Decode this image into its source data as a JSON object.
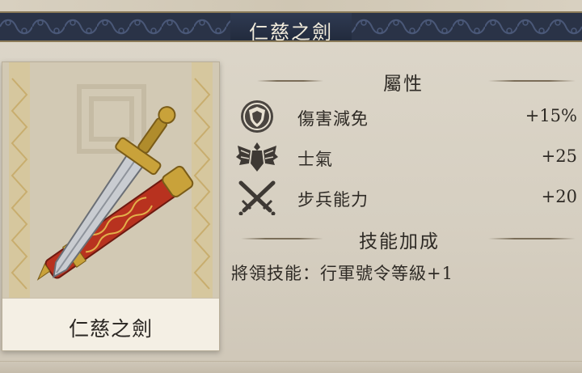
{
  "header": {
    "title": "仁慈之劍"
  },
  "item_card": {
    "name": "仁慈之劍",
    "image_icon": "sword-with-red-scabbard"
  },
  "attributes": {
    "title": "屬性",
    "rows": [
      {
        "icon": "shield-icon",
        "label": "傷害減免",
        "value": "+15%"
      },
      {
        "icon": "eagle-icon",
        "label": "士氣",
        "value": "+25"
      },
      {
        "icon": "crossed-swords-icon",
        "label": "步兵能力",
        "value": "+20"
      }
    ]
  },
  "skill_bonus": {
    "title": "技能加成",
    "text": "將領技能：行軍號令等級+1"
  },
  "colors": {
    "banner": "#2a3347",
    "banner_text": "#f2ecdc",
    "text": "#2e2a25",
    "scabbard": "#b8321f",
    "gold": "#c9a23a"
  }
}
